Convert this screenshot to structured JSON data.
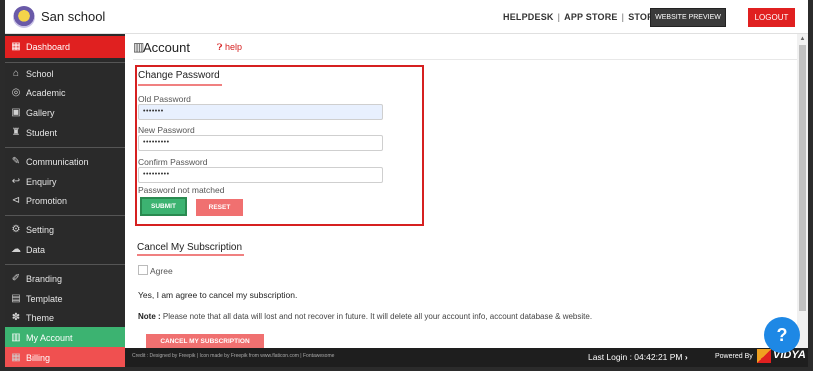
{
  "app": {
    "name": "San school"
  },
  "header": {
    "links": [
      "HELPDESK",
      "APP STORE",
      "STORE"
    ],
    "preview_button": "WEBSITE PREVIEW",
    "logout_button": "LOGOUT"
  },
  "sidebar": {
    "items": [
      {
        "label": "Dashboard",
        "icon": "dashboard-icon",
        "glyph": "▦"
      },
      {
        "label": "School",
        "icon": "school-icon",
        "glyph": "⌂"
      },
      {
        "label": "Academic",
        "icon": "globe-icon",
        "glyph": "◎"
      },
      {
        "label": "Gallery",
        "icon": "image-icon",
        "glyph": "▣"
      },
      {
        "label": "Student",
        "icon": "student-icon",
        "glyph": "♜"
      },
      {
        "label": "Communication",
        "icon": "pen-icon",
        "glyph": "✎"
      },
      {
        "label": "Enquiry",
        "icon": "reply-icon",
        "glyph": "↩"
      },
      {
        "label": "Promotion",
        "icon": "megaphone-icon",
        "glyph": "⊲"
      },
      {
        "label": "Setting",
        "icon": "gear-icon",
        "glyph": "⚙"
      },
      {
        "label": "Data",
        "icon": "cloud-icon",
        "glyph": "☁"
      },
      {
        "label": "Branding",
        "icon": "brush-icon",
        "glyph": "✐"
      },
      {
        "label": "Template",
        "icon": "template-icon",
        "glyph": "▤"
      },
      {
        "label": "Theme",
        "icon": "theme-icon",
        "glyph": "✽"
      },
      {
        "label": "My Account",
        "icon": "account-icon",
        "glyph": "▥"
      },
      {
        "label": "Billing",
        "icon": "billing-icon",
        "glyph": "▦"
      }
    ]
  },
  "main": {
    "title": "Account",
    "help": "help",
    "change_password": {
      "title": "Change Password",
      "old_label": "Old Password",
      "old_value": "•••••••",
      "new_label": "New Password",
      "new_value": "•••••••••",
      "confirm_label": "Confirm Password",
      "confirm_value": "•••••••••",
      "message": "Password not matched",
      "submit": "SUBMIT",
      "reset": "RESET"
    },
    "cancel_subscription": {
      "title": "Cancel My Subscription",
      "agree_label": "Agree",
      "agree_text": "Yes, I am agree to cancel my subscription.",
      "note_label": "Note :",
      "note_text": "Please note that all data will lost and not recover in future. It will delete all your account info, account database & website.",
      "button": "CANCEL MY SUBSCRIPTION"
    }
  },
  "footer": {
    "credit": "Credit : Designed by Freepik | Icon made by Freepik from www.flaticon.com | Fontawesome",
    "last_login": "Last Login : 04:42:21 PM",
    "powered_by": "Powered By",
    "brand": "VIDYA"
  },
  "help_fab": "?",
  "colors": {
    "accent_red": "#e02020",
    "active_green": "#3cb371",
    "sidebar_bg": "#2a2a2a"
  }
}
